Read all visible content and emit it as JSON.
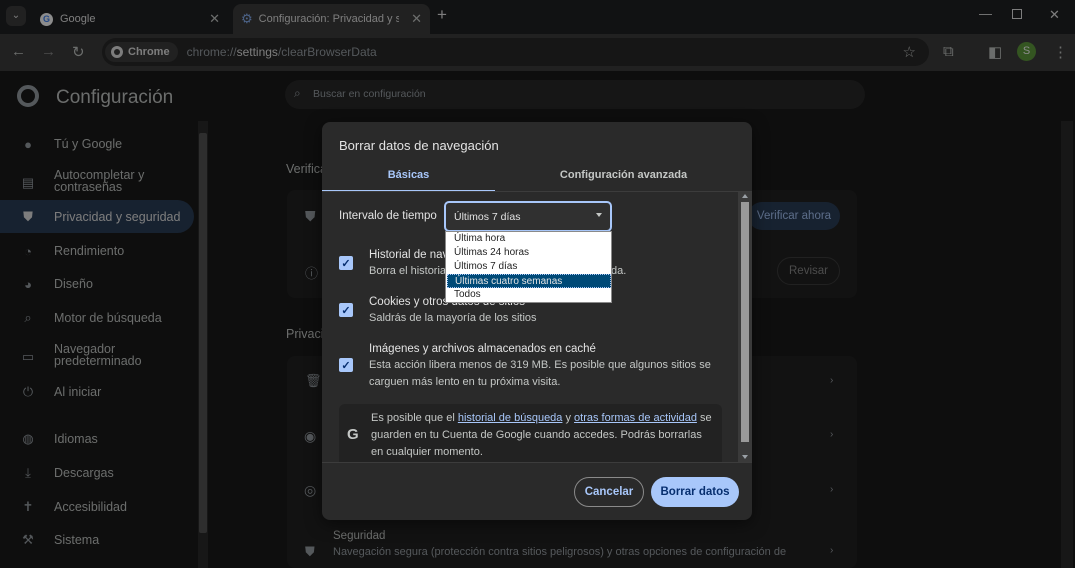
{
  "tabs": [
    {
      "title": "Google",
      "active": false
    },
    {
      "title": "Configuración: Privacidad y seg",
      "active": true
    }
  ],
  "omnibox": {
    "chip": "Chrome",
    "url_prefix": "chrome://",
    "url_host": "settings",
    "url_path": "/clearBrowserData"
  },
  "profile_initial": "S",
  "settings": {
    "title": "Configuración",
    "search_placeholder": "Buscar en configuración",
    "nav": [
      {
        "label": "Tú y Google",
        "icon": "person-icon"
      },
      {
        "label": "Autocompletar y contraseñas",
        "icon": "autofill-icon"
      },
      {
        "label": "Privacidad y seguridad",
        "icon": "shield-icon",
        "selected": true
      },
      {
        "label": "Rendimiento",
        "icon": "speed-icon"
      },
      {
        "label": "Diseño",
        "icon": "palette-icon"
      },
      {
        "label": "Motor de búsqueda",
        "icon": "search-icon"
      },
      {
        "label": "Navegador predeterminado",
        "icon": "browser-icon"
      },
      {
        "label": "Al iniciar",
        "icon": "power-icon"
      },
      {
        "label": "Idiomas",
        "icon": "globe-icon"
      },
      {
        "label": "Descargas",
        "icon": "download-icon"
      },
      {
        "label": "Accesibilidad",
        "icon": "accessibility-icon"
      },
      {
        "label": "Sistema",
        "icon": "wrench-icon"
      }
    ],
    "bg_section_1": "Verifica",
    "verify_button": "Verificar ahora",
    "review_button": "Revisar",
    "bg_section_2": "Privaci",
    "security_title": "Seguridad",
    "security_desc": "Navegación segura (protección contra sitios peligrosos) y otras opciones de configuración de"
  },
  "dialog": {
    "title": "Borrar datos de navegación",
    "tabs": [
      "Básicas",
      "Configuración avanzada"
    ],
    "interval_label": "Intervalo de tiempo",
    "interval_value": "Últimos 7 días",
    "dropdown_options": [
      "Última hora",
      "Últimas 24 horas",
      "Últimos 7 días",
      "Últimas cuatro semanas",
      "Todos"
    ],
    "dropdown_highlighted": "Últimas cuatro semanas",
    "options": [
      {
        "title": "Historial de nave",
        "desc": "Borra el historial",
        "desc_tail": "da.",
        "checked": true
      },
      {
        "title": "Cookies y otros datos de sitios",
        "desc": "Saldrás de la mayoría de los sitios",
        "checked": true
      },
      {
        "title": "Imágenes y archivos almacenados en caché",
        "desc": "Esta acción libera menos de 319 MB. Es posible que algunos sitios se carguen más lento en tu próxima visita.",
        "checked": true
      }
    ],
    "info": {
      "t1": "Es posible que el ",
      "link1": "historial de búsqueda",
      "t2": " y ",
      "link2": "otras formas de actividad",
      "t3": " se guarden en tu Cuenta de Google cuando accedes. Podrás borrarlas en cualquier momento."
    },
    "cancel": "Cancelar",
    "confirm": "Borrar datos"
  },
  "colors": {
    "accent": "#a8c7fa",
    "highlight": "#004a77"
  }
}
